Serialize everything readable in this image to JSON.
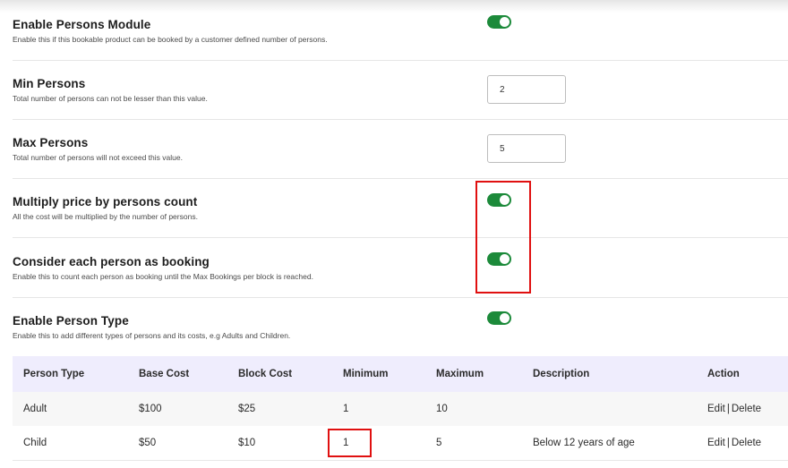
{
  "settings": [
    {
      "title": "Enable Persons Module",
      "desc": "Enable this if this bookable product can be booked by a customer defined number of persons.",
      "control": "toggle",
      "enabled": true
    },
    {
      "title": "Min Persons",
      "desc": "Total number of persons can not be lesser than this value.",
      "control": "number",
      "value": "2"
    },
    {
      "title": "Max Persons",
      "desc": "Total number of persons will not exceed this value.",
      "control": "number",
      "value": "5"
    },
    {
      "title": "Multiply price by persons count",
      "desc": "All the cost will be multiplied by the number of persons.",
      "control": "toggle",
      "enabled": true
    },
    {
      "title": "Consider each person as booking",
      "desc": "Enable this to count each person as booking until the Max Bookings per block is reached.",
      "control": "toggle",
      "enabled": true
    },
    {
      "title": "Enable Person Type",
      "desc": "Enable this to add different types of persons and its costs, e.g Adults and Children.",
      "control": "toggle",
      "enabled": true
    }
  ],
  "person_table": {
    "headers": [
      "Person Type",
      "Base Cost",
      "Block Cost",
      "Minimum",
      "Maximum",
      "Description",
      "Action"
    ],
    "rows": [
      {
        "type": "Adult",
        "base": "$100",
        "block": "$25",
        "min": "1",
        "max": "10",
        "desc": "",
        "edit": "Edit",
        "delete": "Delete"
      },
      {
        "type": "Child",
        "base": "$50",
        "block": "$10",
        "min": "1",
        "max": "5",
        "desc": "Below 12 years of age",
        "edit": "Edit",
        "delete": "Delete"
      }
    ]
  },
  "colors": {
    "toggle_on": "#1c8a3a",
    "highlight": "#e01010",
    "table_header_bg": "#efedfd"
  }
}
